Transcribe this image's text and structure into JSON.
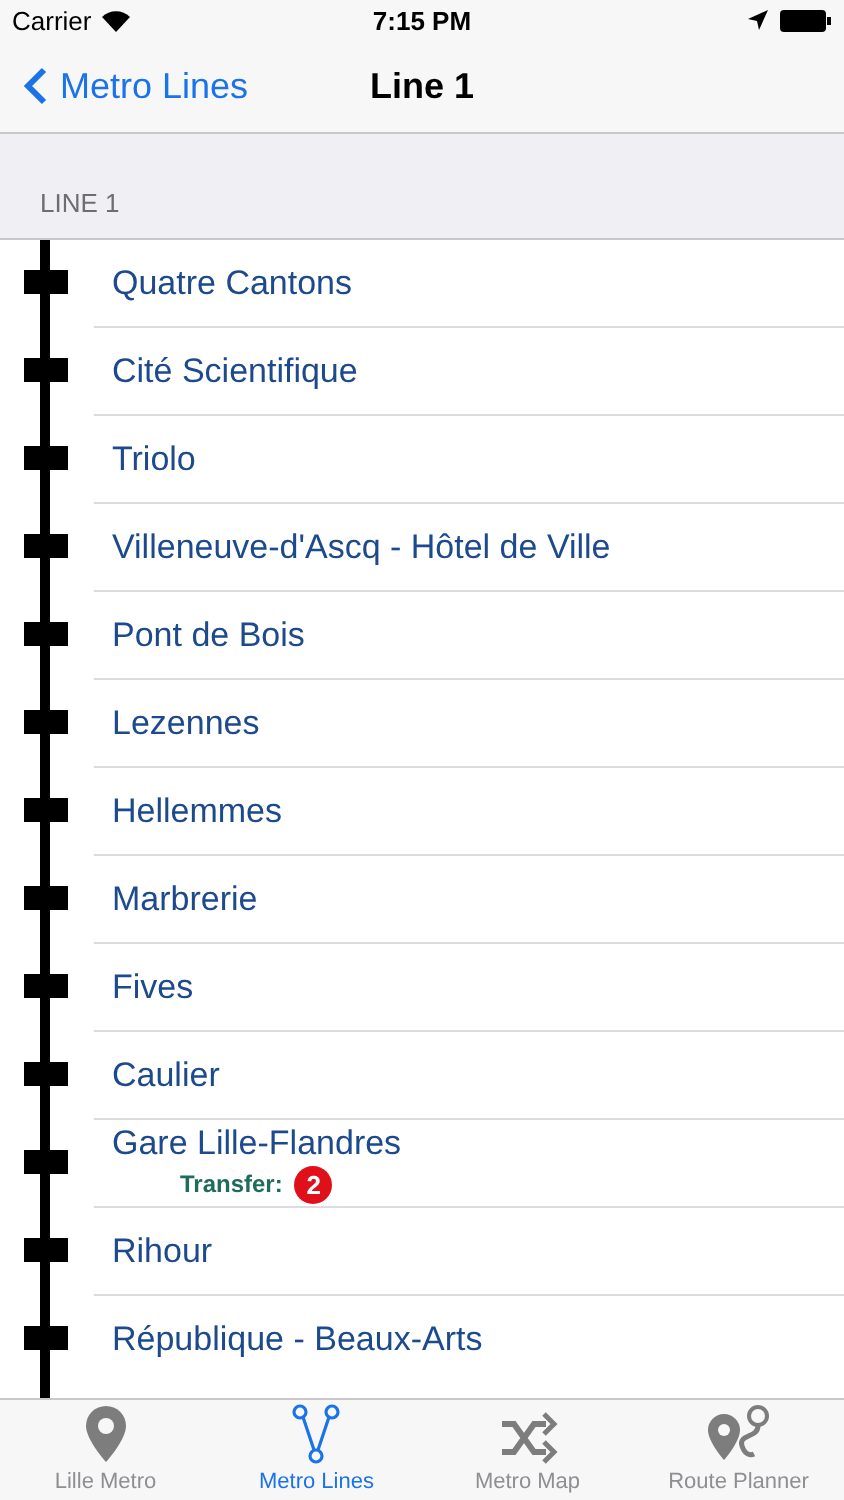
{
  "status_bar": {
    "carrier": "Carrier",
    "time": "7:15 PM"
  },
  "nav": {
    "back": "Metro Lines",
    "title": "Line 1"
  },
  "section_header": "LINE 1",
  "stations": [
    {
      "name": "Quatre Cantons"
    },
    {
      "name": "Cité Scientifique"
    },
    {
      "name": "Triolo"
    },
    {
      "name": "Villeneuve-d'Ascq - Hôtel de Ville"
    },
    {
      "name": "Pont de Bois"
    },
    {
      "name": "Lezennes"
    },
    {
      "name": "Hellemmes"
    },
    {
      "name": "Marbrerie"
    },
    {
      "name": "Fives"
    },
    {
      "name": "Caulier"
    },
    {
      "name": "Gare Lille-Flandres",
      "transfer": {
        "label": "Transfer:",
        "lines": [
          "2"
        ]
      }
    },
    {
      "name": "Rihour"
    },
    {
      "name": "République - Beaux-Arts"
    }
  ],
  "tabs": [
    {
      "kind": "pin",
      "label": "Lille Metro",
      "selected": false
    },
    {
      "kind": "lines",
      "label": "Metro Lines",
      "selected": true
    },
    {
      "kind": "shuffle",
      "label": "Metro Map",
      "selected": false
    },
    {
      "kind": "route",
      "label": "Route Planner",
      "selected": false
    }
  ]
}
